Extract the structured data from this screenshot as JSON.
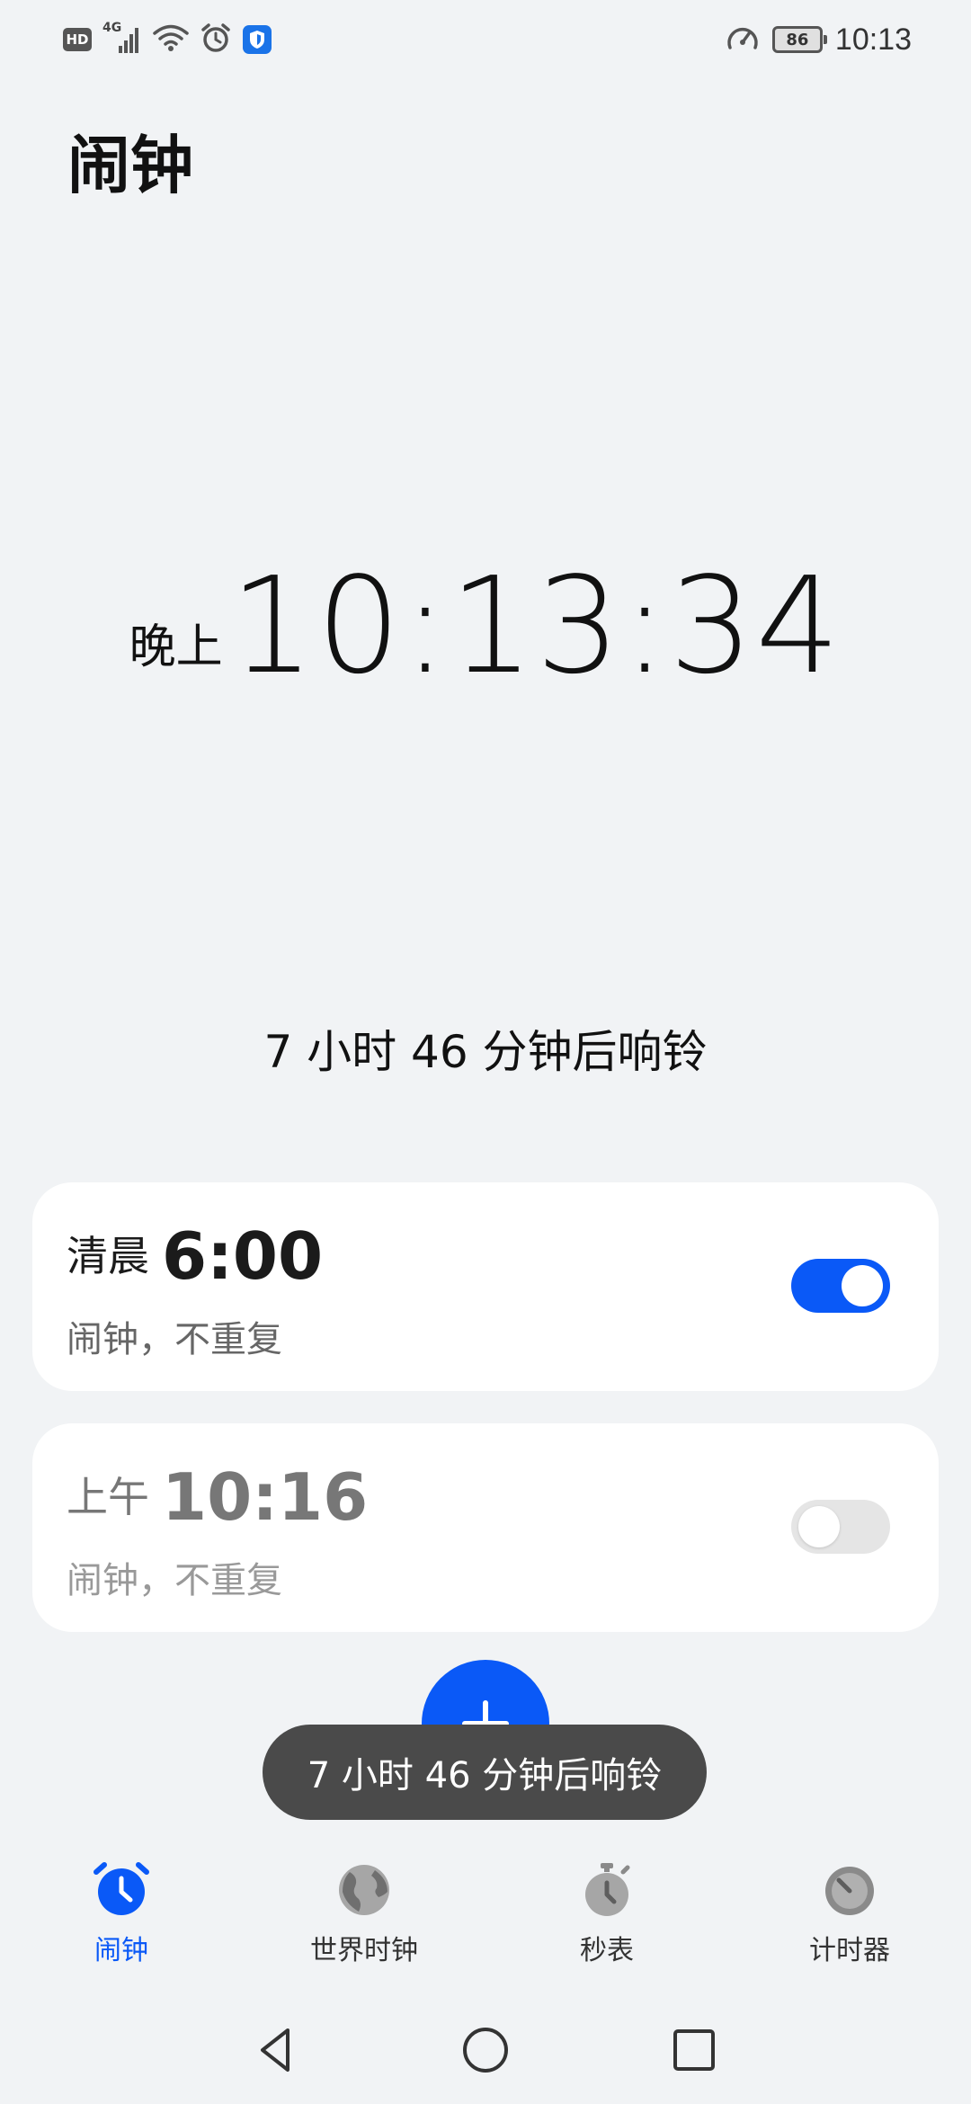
{
  "status_bar": {
    "hd": "HD",
    "network": "4G",
    "battery": "86",
    "time": "10:13"
  },
  "page_title": "闹钟",
  "clock": {
    "period": "晚上",
    "time": "10:13:34"
  },
  "next_ring": "7 小时 46 分钟后响铃",
  "alarms": [
    {
      "period": "清晨",
      "time": "6:00",
      "sub": "闹钟，不重复",
      "enabled": true
    },
    {
      "period": "上午",
      "time": "10:16",
      "sub": "闹钟，不重复",
      "enabled": false
    }
  ],
  "toast": "7 小时 46 分钟后响铃",
  "tabs": [
    {
      "label": "闹钟",
      "icon": "alarm-clock-icon",
      "active": true
    },
    {
      "label": "世界时钟",
      "icon": "globe-icon",
      "active": false
    },
    {
      "label": "秒表",
      "icon": "stopwatch-icon",
      "active": false
    },
    {
      "label": "计时器",
      "icon": "timer-icon",
      "active": false
    }
  ],
  "colors": {
    "accent": "#0a59f7",
    "background": "#f1f3f5",
    "toast_bg": "#4a4a4a"
  }
}
